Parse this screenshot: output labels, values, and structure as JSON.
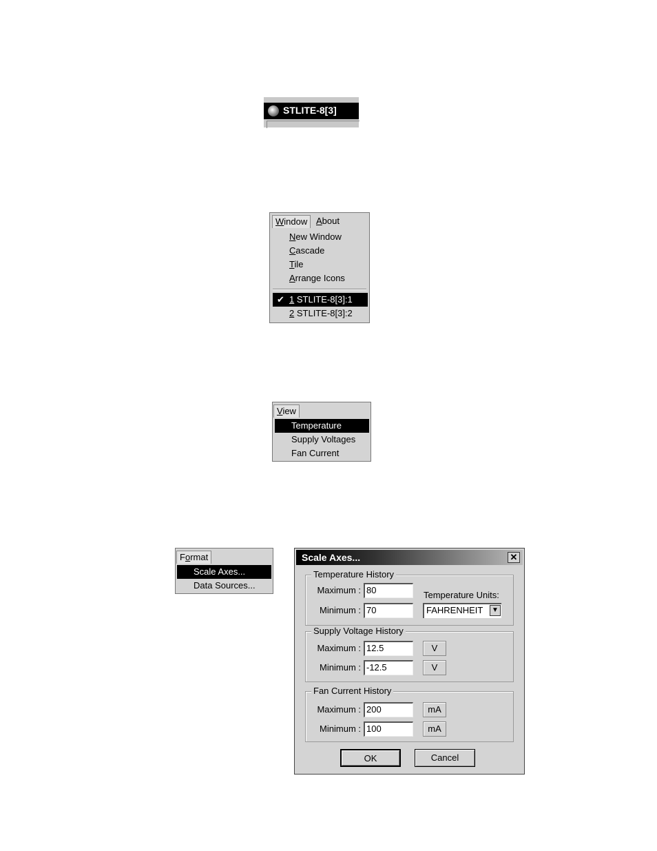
{
  "title_strip": {
    "title": "STLITE-8[3]"
  },
  "window_menu": {
    "menubar": [
      "Window",
      "About"
    ],
    "items": [
      "New Window",
      "Cascade",
      "Tile",
      "Arrange Icons"
    ],
    "windows": [
      "1 STLITE-8[3]:1",
      "2 STLITE-8[3]:2"
    ],
    "checkmark": "✔"
  },
  "view_menu": {
    "menubar": "View",
    "items": [
      "Temperature",
      "Supply Voltages",
      "Fan Current"
    ]
  },
  "format_menu": {
    "menubar": "Format",
    "items": [
      "Scale Axes...",
      "Data Sources..."
    ]
  },
  "dialog": {
    "title": "Scale Axes...",
    "close": "✕",
    "temperature": {
      "legend": "Temperature History",
      "max_label": "Maximum :",
      "max_value": "80",
      "min_label": "Minimum :",
      "min_value": "70",
      "units_label": "Temperature Units:",
      "units_value": "FAHRENHEIT"
    },
    "voltage": {
      "legend": "Supply Voltage History",
      "max_label": "Maximum :",
      "max_value": "12.5",
      "max_unit": "V",
      "min_label": "Minimum :",
      "min_value": "-12.5",
      "min_unit": "V"
    },
    "fan": {
      "legend": "Fan Current History",
      "max_label": "Maximum :",
      "max_value": "200",
      "max_unit": "mA",
      "min_label": "Minimum :",
      "min_value": "100",
      "min_unit": "mA"
    },
    "ok": "OK",
    "cancel": "Cancel"
  }
}
